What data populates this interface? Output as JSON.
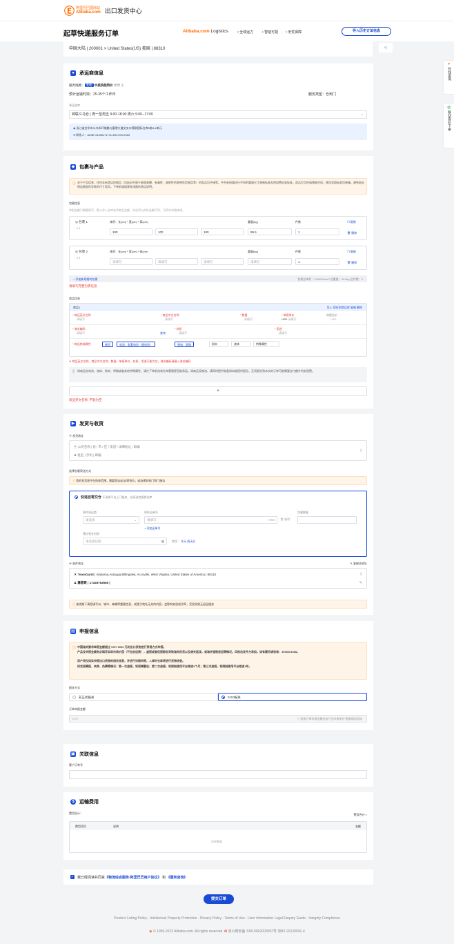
{
  "topbar": {
    "logo_cn": "阿里巴巴国际站",
    "logo_en": "Alibaba.com",
    "title": "出口发货中心"
  },
  "header": {
    "page_title": "起草快递服务订单",
    "brand": "Alibaba.com",
    "brand_suffix": "Logistics",
    "features": [
      "• 全球运力",
      "• 智能可视",
      "• 无忧保障"
    ],
    "history_button": "导入历史订单信息"
  },
  "route": {
    "text": "中国大陆 | 200001 > United States(US) 美国 | 88310"
  },
  "side": {
    "online": "在线咨询",
    "mobile": "移动查价下单"
  },
  "carrier": {
    "title": "承运商信息",
    "line_label": "服务线路：",
    "line_badge": "无忧",
    "line_name": "中美快船特价",
    "line_link": "修改",
    "eta": "预计运输时效：25-35个工作日",
    "service_type": "服务类型：仓到门",
    "warehouse_label": "承运仓库",
    "warehouse_value": "锦联义乌仓 | 周一至周五 9:00-18:00 周六 9:00--17:00",
    "address": "浙江省金华市义乌市环城路与富港大道交叉口锦联国际仓库5栋3-4单元",
    "contact": "联系人：ALBB 13185171711;400-999-0353"
  },
  "package": {
    "title": "包裹与产品",
    "notice": "关于产品信息，任何含有禁运的物品（包括但不限于易燃易爆、有毒性、放射性的各种危险物品等）的商品均不接受。平台各线路执行不同的重量尺寸限制标准及附加费征收标准，商品打包时请预留空间，使用坚固标准包装箱，避免因尖锐运输变形导致的尺寸差异。下单前请留意各线路的承运说明。",
    "info_label": "包裹信息",
    "info_hint": "单报金额只需要填写，默认导入仓库合同商品金额，如合同与实际金额不同，可再次单独修改。",
    "packages": [
      {
        "name": "包裹 1",
        "qty": "x 1",
        "dims_label": "体积：长(cm) * 宽(cm) * 高(cm)",
        "weight_label": "重量(kg)",
        "count_label": "件数",
        "l": "100",
        "w": "100",
        "h": "100",
        "weight": "99.5",
        "count": "1",
        "copy": "复制",
        "delete": "删除"
      },
      {
        "name": "包裹 2",
        "qty": "x 1",
        "dims_label": "体积：长(cm) * 宽(cm) * 高(cm)",
        "weight_label": "重量(kg)",
        "count_label": "件数",
        "l": "请填写",
        "w": "请填写",
        "h": "请填写",
        "weight": "请填写",
        "count": "1",
        "copy": "复制",
        "delete": "删除"
      }
    ],
    "add_package": "+ 添加新规格的包裹",
    "summary": "包裹总体积：1000000cm³     总重量：99.5kg     总件数：2",
    "pkg_error": "请填写完整包裹信息",
    "goods_label": "商品信息",
    "goods_head": "商品1",
    "goods_actions": "导入  保存到商品库  复制  删除",
    "fields": {
      "en_name": "* 商品英文名称",
      "cn_name": "* 商品中文名称",
      "qty": "* 数量",
      "price": "* 单报单价",
      "total": "申报总价",
      "hs": "* 海关编码",
      "material": "* 材质",
      "use": "* 用途",
      "placeholder": "请填写",
      "usd": "USD",
      "query": "查询",
      "props": "* 商品物流属性"
    },
    "props": {
      "tags": [
        "普货",
        "电池：配套电池（锂电池）",
        "锂电：固储"
      ],
      "opts": [
        "粉末",
        "液体",
        "特殊属性"
      ]
    },
    "err1": "商品英文名称、商品中文名称、数量、单报单价、材质、用途不能为空，海关编码请填入海关编码",
    "notice2": "如商品含电池、液体、粉末、带磁或者其他特殊属性，请在下单前咨询仓库客服是否能承运。如商品没物流、请同时提供准备如实能提供报告，无须报给到本次的订单可能需要支付额外的处理费。",
    "add": "+",
    "err2": "商品英文名称: 不能为空"
  },
  "shipping": {
    "title": "发货与收货",
    "sender_label": "发货地址",
    "sender_ph1": "公司名称 | 省 / 市 / 区 / 街道 / 详细地址 | 邮编",
    "sender_ph2": "姓名 | 手机 | 邮编",
    "method_label": "选择包裹寄送方式",
    "method_notice": "您的发货地不在揽收范围，需要您自送/自寄到仓，或选择其他门到门服务",
    "option_title": "快递自寄交仓",
    "option_hint": "不选择平台上门服务，自寄送包裹到仓库",
    "carrier_label": "寄件承运商",
    "carrier_ph": "请选择",
    "tracking_label": "寄件运单号",
    "tracking_ph": "请填写",
    "tracking_count": "0/50",
    "tracking_delete": "删除",
    "add_tracking": "+ 添加运单号",
    "pkgcount_label": "包裹数量",
    "date_label": "预计到仓时间",
    "date_ph": "请选择日期",
    "quick_label": "常用：",
    "today": "今天",
    "after2": "两天后",
    "receiver_label": "收件地址",
    "receiver_action": "复制本地址",
    "receiver_name": "TeamGantt",
    "receiver_addr": " | Alabama,Autauga,Billingsley, Accoville, West Virginia, United States of America | 88310",
    "receiver_contact": "慕蓉哥 | 17328763586 |",
    "receiver_notice": "该线路下请您填写州、城市、邮编等重要信息，或是引地址无关的内容，会影响安投成功率，妥投失败无退运服务"
  },
  "declare": {
    "title": "申报信息",
    "notice_lines": [
      "中国海关要求单报金额超过 CNY 5000 元的出口货物进行贸易方式申报。",
      "产品及申报金额务必填写实际市场价值（不包含运费），虚报或者低报都会导致海关扣货以及清关延误，或海关强制退运等情况。风险自发件方承担。如有疑问请咨询：4008261688。",
      "用户须仅如实申报出口货物的相关信息，并进行详细申报，入库时仓库将进行货物核查。",
      "如发现瞒报、夹带、伪瞒等情况：第一次违规，将视情警告；第二次违规，将限制使用平台物流3个月；第三次违规，将限制使用平台物流1年。"
    ],
    "mode_label": "报关方式",
    "mode_a": "非正式报关",
    "mode_b": "0110报关",
    "amount_label": "订单申报金额",
    "amount_unit": "USD",
    "amount_hint": "物流订单申报金额由各产品申报单价*数量相加而成"
  },
  "related": {
    "title": "关联信息",
    "label": "客户订单号"
  },
  "fees": {
    "title": "运输费用",
    "total_label": "费用总计：",
    "detail_link": "费用合计 >",
    "cols": [
      "费用项目",
      "说明",
      "金额"
    ],
    "empty": "没有数据"
  },
  "agree": {
    "prefix": "我已经阅读并同意",
    "link1": "《物流综合服务-阿里巴巴用户协议》",
    "and": "和",
    "link2": "《服务咨询》"
  },
  "submit": "提交订单",
  "footer": {
    "links": "Product Listing Policy - Intellectual Property Protection - Privacy Policy - Terms of Use - User Information Legal Enquiry Guide - Integrity Compliance",
    "copy": "© 1999-2023 Alibaba.com. All rights reserved.",
    "beian": "浙公网安备 33010002000092号",
    "icp": "浙B2-20120091-4"
  },
  "colors": {
    "accent": "#1a4bd6",
    "orange": "#ff6a00",
    "error": "#e53935",
    "warn_bg": "#fff4e8"
  }
}
